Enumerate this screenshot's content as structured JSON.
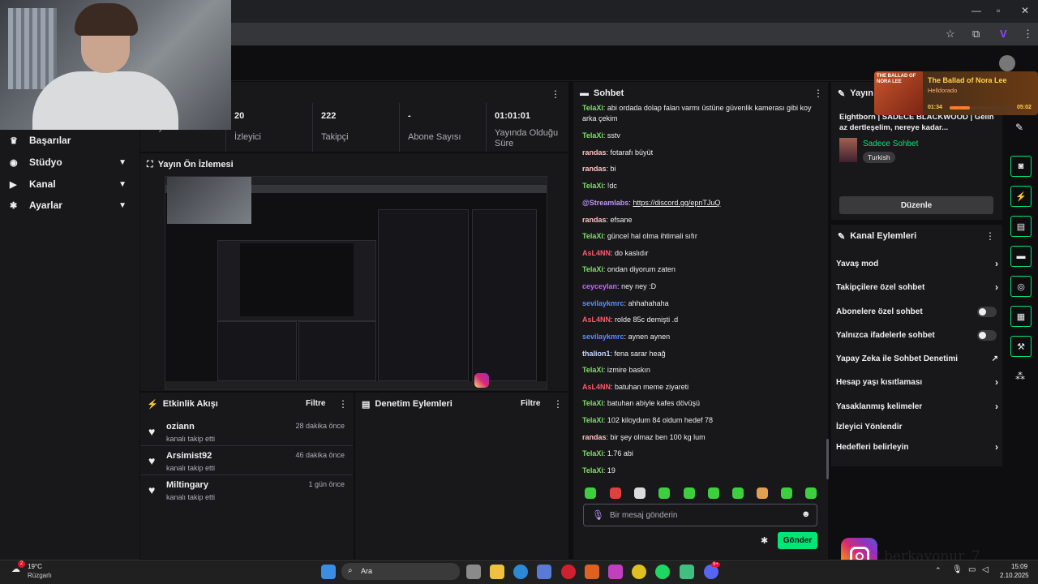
{
  "sidebar": {
    "items": [
      {
        "label": "Başarılar",
        "icon": "trophy-icon"
      },
      {
        "label": "Stüdyo",
        "icon": "studio-icon"
      },
      {
        "label": "Kanal",
        "icon": "channel-icon"
      },
      {
        "label": "Ayarlar",
        "icon": "gear-icon"
      }
    ]
  },
  "stats": {
    "first_label": "Yayın",
    "items": [
      {
        "value": "20",
        "label": "İzleyici"
      },
      {
        "value": "222",
        "label": "Takipçi"
      },
      {
        "value": "-",
        "label": "Abone Sayısı"
      },
      {
        "value": "01:01:01",
        "label": "Yayında Olduğu Süre"
      }
    ]
  },
  "preview": {
    "title": "Yayın Ön İzlemesi"
  },
  "activity": {
    "title": "Etkinlik Akışı",
    "filter": "Filtre",
    "events": [
      {
        "name": "oziann",
        "action": "kanalı takip etti",
        "time": "28 dakika önce"
      },
      {
        "name": "Arsimist92",
        "action": "kanalı takip etti",
        "time": "46 dakika önce"
      },
      {
        "name": "Miltingary",
        "action": "kanalı takip etti",
        "time": "1 gün önce"
      }
    ]
  },
  "moderation": {
    "title": "Denetim Eylemleri",
    "filter": "Filtre"
  },
  "chat": {
    "title": "Sohbet",
    "messages": [
      {
        "user": "TelaXi",
        "color": "#7fe068",
        "text": "abi ordada dolap falan varmı üstüne güvenlik kamerası gibi koy arka çekim"
      },
      {
        "user": "TelaXi",
        "color": "#7fe068",
        "text": "sstv"
      },
      {
        "user": "randas",
        "color": "#ffc0c0",
        "text": "fotarafı büyüt"
      },
      {
        "user": "randas",
        "color": "#ffc0c0",
        "text": "bi"
      },
      {
        "user": "TelaXi",
        "color": "#7fe068",
        "text": "!dc"
      },
      {
        "user": "@Streamlabs",
        "color": "#bf94ff",
        "text": "https://discord.gg/epnTJuQ"
      },
      {
        "user": "randas",
        "color": "#ffc0c0",
        "text": "efsane"
      },
      {
        "user": "TelaXi",
        "color": "#7fe068",
        "text": "güncel hal olma ihtimali sıfır"
      },
      {
        "user": "AsL4NN",
        "color": "#ff5a6e",
        "text": "do kaslıdır"
      },
      {
        "user": "TelaXi",
        "color": "#7fe068",
        "text": "ondan diyorum zaten"
      },
      {
        "user": "ceyceylan",
        "color": "#c766ff",
        "text": "ney ney :D"
      },
      {
        "user": "sevilaykmrc",
        "color": "#5b8cff",
        "text": "ahhahahaha"
      },
      {
        "user": "AsL4NN",
        "color": "#ff5a6e",
        "text": "rolde 85c demişti .d"
      },
      {
        "user": "sevilaykmrc",
        "color": "#5b8cff",
        "text": "aynen aynen"
      },
      {
        "user": "thalion1",
        "color": "#c9d7ff",
        "text": "fena sarar heağ"
      },
      {
        "user": "TelaXi",
        "color": "#7fe068",
        "text": "izmire baskın"
      },
      {
        "user": "AsL4NN",
        "color": "#ff5a6e",
        "text": "batuhan meme ziyareti"
      },
      {
        "user": "TelaXi",
        "color": "#7fe068",
        "text": "batuhan abiyle kafes dövüşü"
      },
      {
        "user": "TelaXi",
        "color": "#7fe068",
        "text": "102 kiloydum 84 oldum hedef 78"
      },
      {
        "user": "randas",
        "color": "#ffc0c0",
        "text": "bir şey olmaz ben 100 kg lum"
      },
      {
        "user": "TelaXi",
        "color": "#7fe068",
        "text": "1.76 abi"
      },
      {
        "user": "TelaXi",
        "color": "#7fe068",
        "text": "19"
      }
    ],
    "input_placeholder": "Bir mesaj gönderin",
    "send": "Gönder"
  },
  "stream_info": {
    "title_short": "Yayın bi",
    "stream_title": "Eightborn | SADECE BLACKWOOD | Gelin az dertleşelim, nereye kadar...",
    "category": "Sadece Sohbet",
    "tag": "Turkish",
    "edit": "Düzenle"
  },
  "channel_actions": {
    "title": "Kanal Eylemleri",
    "items": [
      {
        "label": "Yavaş mod",
        "control": "chevron"
      },
      {
        "label": "Takipçilere özel sohbet",
        "control": "chevron"
      },
      {
        "label": "Abonelere özel sohbet",
        "control": "toggle"
      },
      {
        "label": "Yalnızca ifadelerle sohbet",
        "control": "toggle"
      },
      {
        "label": "Yapay Zeka ile Sohbet Denetimi",
        "control": "external"
      },
      {
        "label": "Hesap yaşı kısıtlaması",
        "control": "chevron"
      },
      {
        "label": "Yasaklanmış kelimeler",
        "control": "chevron"
      },
      {
        "label": "İzleyici Yönlendir",
        "control": "none"
      },
      {
        "label": "Hedefleri belirleyin",
        "control": "chevron"
      }
    ]
  },
  "music": {
    "title": "The Ballad of Nora Lee",
    "artist": "Helldorado",
    "elapsed": "01:34",
    "total": "05:02",
    "progress": 0.31,
    "cover_text": "THE BALLAD OF NORA LEE"
  },
  "overlay": {
    "handle": "berkayonur_7"
  },
  "taskbar": {
    "weather_temp": "19°C",
    "weather_desc": "Rüzgarlı",
    "weather_badge": "2",
    "search": "Ara",
    "time": "15:09",
    "date": "2.10.2025",
    "discord_badge": "9+"
  },
  "colors": {
    "accent": "#00e676",
    "background": "#0e0e10",
    "panel": "#18181b",
    "music_title": "#ffd24a"
  }
}
